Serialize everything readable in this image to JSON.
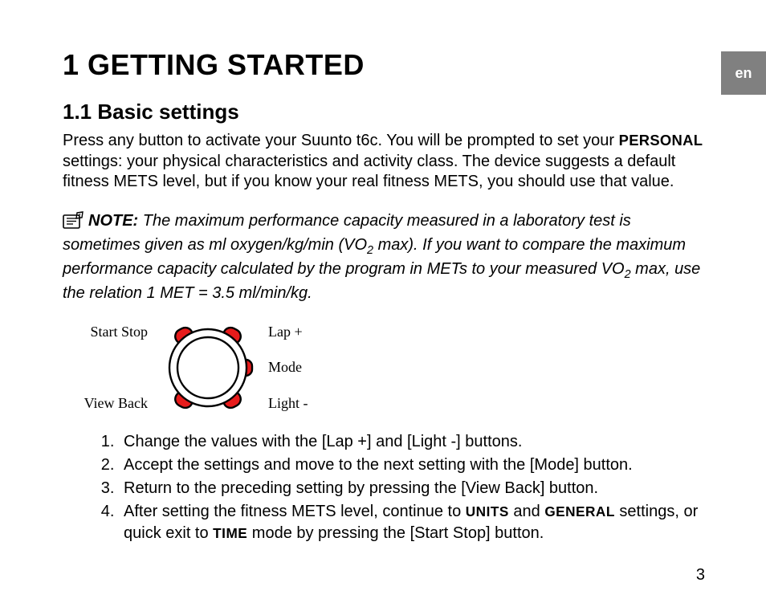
{
  "lang_tab": "en",
  "chapter": {
    "num": "1",
    "title": "GETTING STARTED"
  },
  "section": {
    "num": "1.1",
    "title": "Basic settings"
  },
  "para1_a": "Press any button to activate your Suunto t6c. You will be prompted to set your ",
  "para1_sc": "PERSONAL",
  "para1_b": " settings: your physical characteristics and activity class. The device suggests a default fitness METS level, but if you know your real fitness METS, you should use that value.",
  "note": {
    "label": "NOTE:",
    "a": " The maximum performance capacity measured in a laboratory test is sometimes given as ml oxygen/kg/min (VO",
    "sub1": "2",
    "b": " max). If you want to compare the maximum performance capacity calculated by the program in METs to your measured VO",
    "sub2": "2",
    "c": " max, use the relation 1 MET = 3.5 ml/min/kg."
  },
  "diagram": {
    "top_left": "Start Stop",
    "bottom_left": "View Back",
    "top_right": "Lap +",
    "mid_right": "Mode",
    "bottom_right": "Light -"
  },
  "steps": {
    "s1": "Change the values with the [Lap +] and [Light -] buttons.",
    "s2": "Accept the settings and move to the next setting with the [Mode] button.",
    "s3": "Return to the preceding setting by pressing the [View Back] button.",
    "s4a": "After setting the fitness METS level, continue to ",
    "s4_sc1": "UNITS",
    "s4b": " and ",
    "s4_sc2": "GENERAL",
    "s4c": " settings, or quick exit to ",
    "s4_sc3": "TIME",
    "s4d": " mode by pressing the [Start Stop] button."
  },
  "page_number": "3"
}
